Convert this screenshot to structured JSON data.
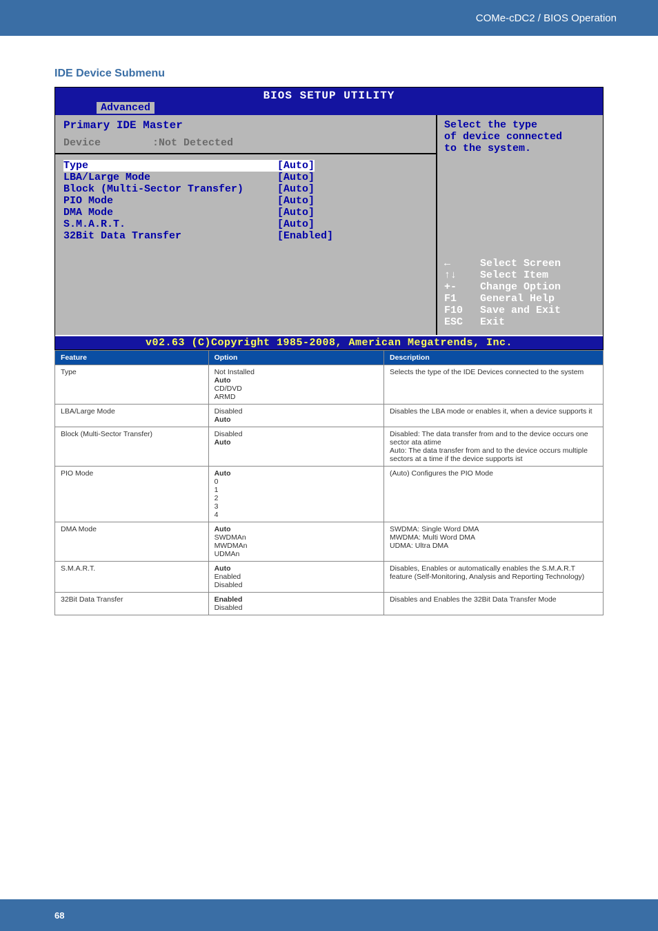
{
  "header": {
    "breadcrumb": "COMe-cDC2 / BIOS Operation"
  },
  "heading": "IDE Device Submenu",
  "bios": {
    "title": "BIOS SETUP UTILITY",
    "tab": "Advanced",
    "left_heading": "Primary IDE Master",
    "device_label": "Device",
    "device_value": ":Not Detected",
    "items": [
      {
        "label": "Type",
        "value": "[Auto]",
        "selected": true
      },
      {
        "label": "LBA/Large Mode",
        "value": "[Auto]"
      },
      {
        "label": "Block (Multi-Sector Transfer)",
        "value": "[Auto]"
      },
      {
        "label": "PIO Mode",
        "value": "[Auto]"
      },
      {
        "label": "DMA Mode",
        "value": "[Auto]"
      },
      {
        "label": "S.M.A.R.T.",
        "value": "[Auto]"
      },
      {
        "label": "32Bit Data Transfer",
        "value": "[Enabled]"
      }
    ],
    "help_line1": "Select the type",
    "help_line2": "of device connected",
    "help_line3": "to the system.",
    "keys": [
      {
        "k": "←",
        "t": "Select Screen"
      },
      {
        "k": "↑↓",
        "t": "Select Item"
      },
      {
        "k": "+-",
        "t": "Change Option"
      },
      {
        "k": "F1",
        "t": "General Help"
      },
      {
        "k": "F10",
        "t": "Save and Exit"
      },
      {
        "k": "ESC",
        "t": "Exit"
      }
    ],
    "footer": "v02.63 (C)Copyright 1985-2008, American Megatrends, Inc."
  },
  "table": {
    "headers": {
      "feature": "Feature",
      "option": "Option",
      "description": "Description"
    },
    "rows": [
      {
        "feature": "Type",
        "options": [
          "Not Installed",
          "Auto",
          "CD/DVD",
          "ARMD"
        ],
        "bold": [
          1
        ],
        "desc": "Selects the type of the IDE Devices connected to the system"
      },
      {
        "feature": "LBA/Large Mode",
        "options": [
          "Disabled",
          "Auto"
        ],
        "bold": [
          1
        ],
        "desc": "Disables the LBA mode or enables it, when a device supports it"
      },
      {
        "feature": "Block (Multi-Sector Transfer)",
        "options": [
          "Disabled",
          "Auto"
        ],
        "bold": [
          1
        ],
        "desc": "Disabled: The data transfer from and to the device occurs one sector ata atime\nAuto: The data transfer from and to the device occurs multiple sectors at a time if the device supports ist"
      },
      {
        "feature": "PIO Mode",
        "options": [
          "Auto",
          "0",
          "1",
          "2",
          "3",
          "4"
        ],
        "bold": [
          0
        ],
        "desc": "(Auto) Configures the PIO Mode"
      },
      {
        "feature": "DMA Mode",
        "options": [
          "Auto",
          "SWDMAn",
          "MWDMAn",
          "UDMAn"
        ],
        "bold": [
          0
        ],
        "desc": "SWDMA: Single Word DMA\nMWDMA: Multi Word DMA\nUDMA: Ultra DMA"
      },
      {
        "feature": "S.M.A.R.T.",
        "options": [
          "Auto",
          "Enabled",
          "Disabled"
        ],
        "bold": [
          0
        ],
        "desc": "Disables, Enables or automatically enables the S.M.A.R.T feature (Self-Monitoring, Analysis and Reporting Technology)"
      },
      {
        "feature": "32Bit Data Transfer",
        "options": [
          "Enabled",
          "Disabled"
        ],
        "bold": [
          0
        ],
        "desc": "Disables and Enables the 32Bit Data Transfer Mode"
      }
    ]
  },
  "footer": {
    "page": "68"
  }
}
